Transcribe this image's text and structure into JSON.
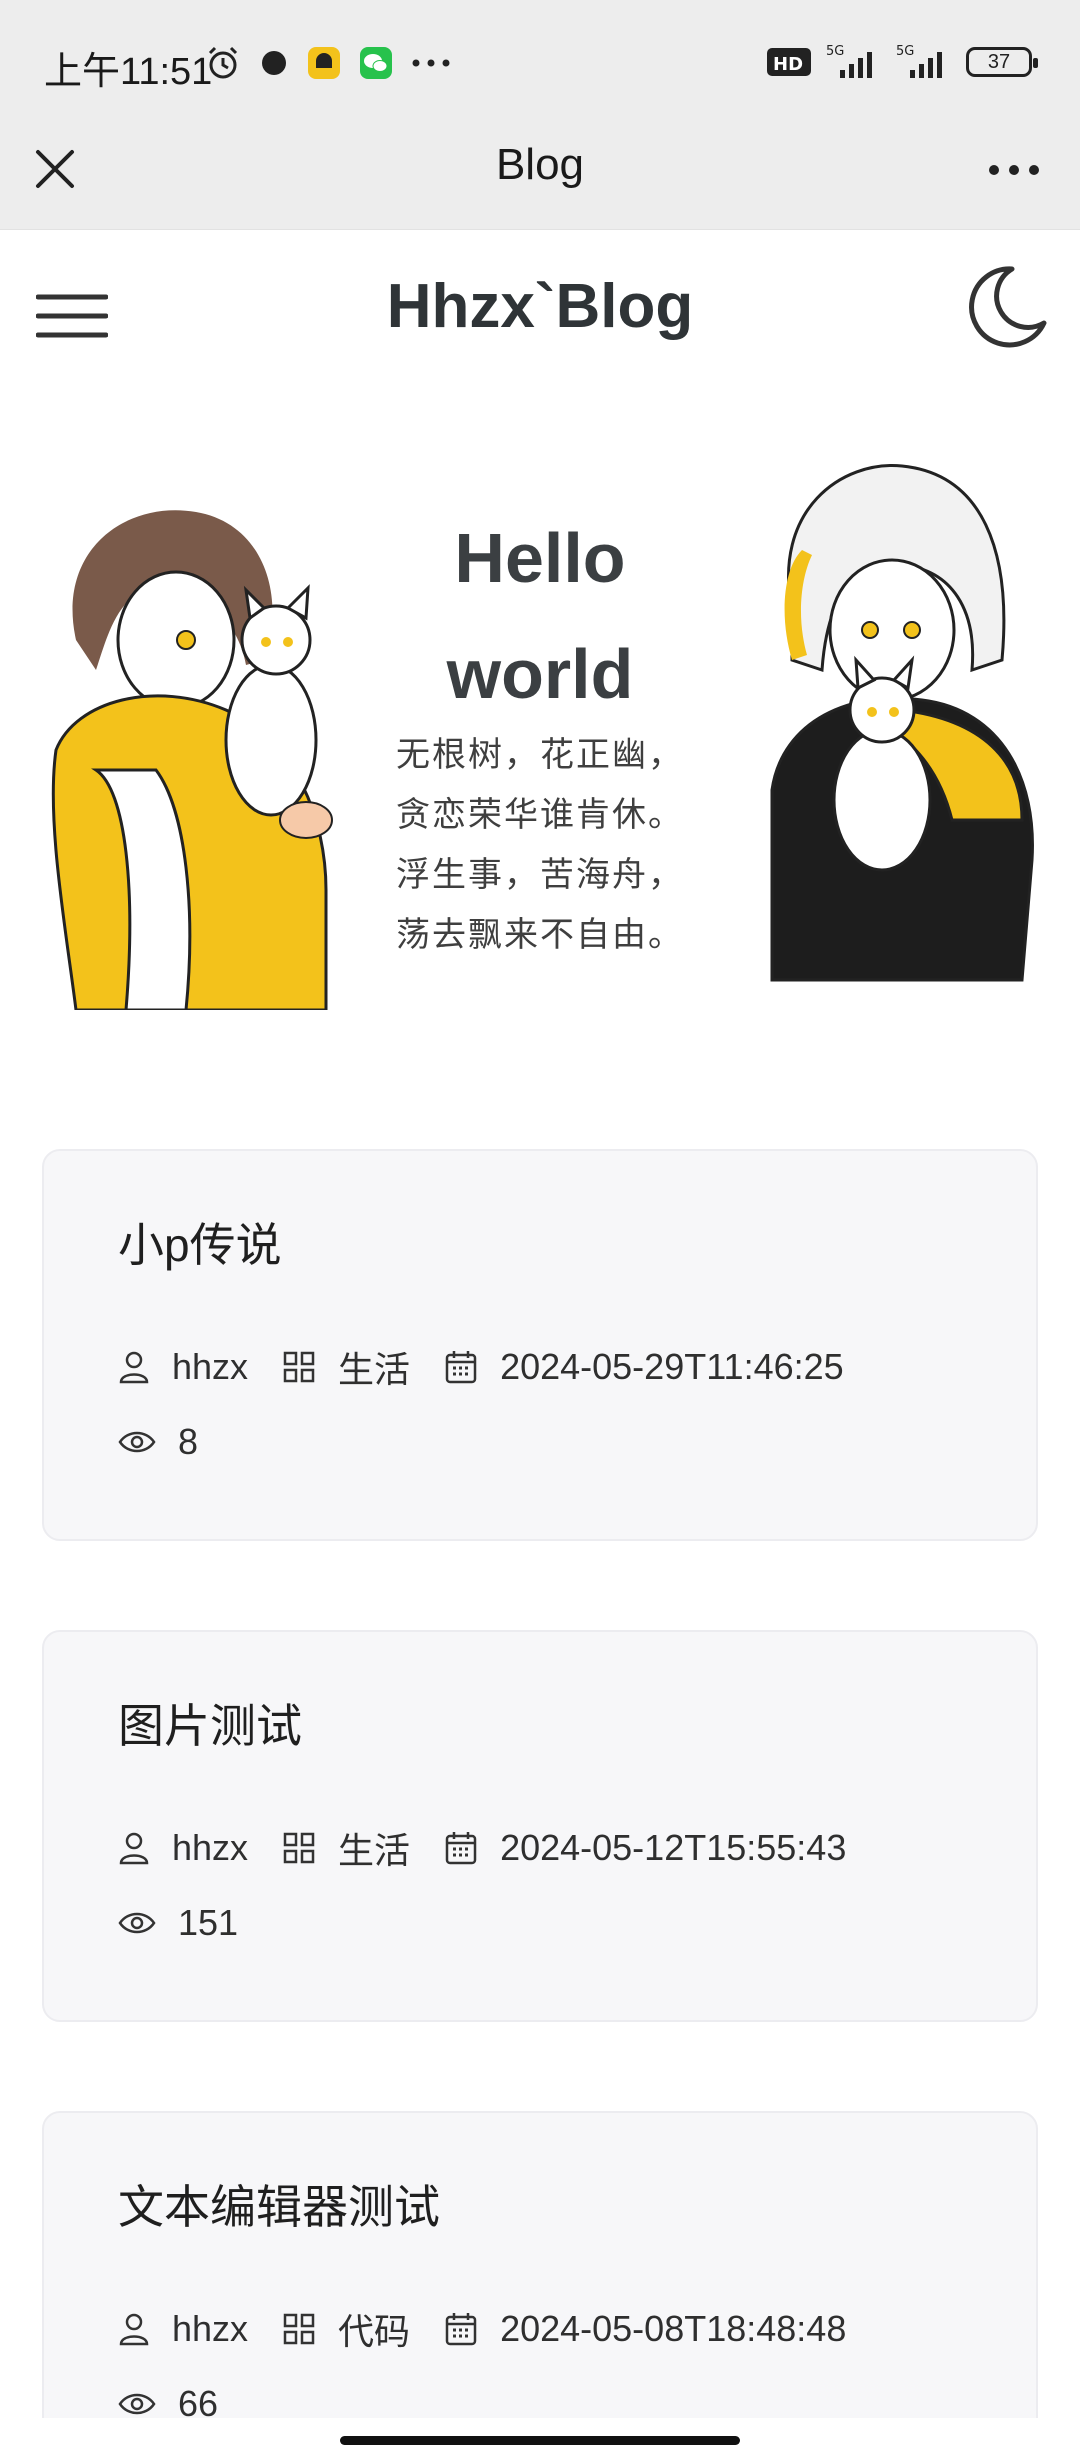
{
  "status_bar": {
    "time": "上午11:51",
    "network_1": "5G",
    "network_2": "5G",
    "hd_label": "HD",
    "battery": "37"
  },
  "browser": {
    "title": "Blog"
  },
  "site": {
    "title": "Hhzx`Blog"
  },
  "hero": {
    "heading_line1": "Hello",
    "heading_line2": "world",
    "poem": [
      "无根树，花正幽，",
      "贪恋荣华谁肯休。",
      "浮生事，苦海舟，",
      "荡去飘来不自由。"
    ]
  },
  "posts": [
    {
      "title": "小p传说",
      "author": "hhzx",
      "category": "生活",
      "date": "2024-05-29T11:46:25",
      "views": "8"
    },
    {
      "title": "图片测试",
      "author": "hhzx",
      "category": "生活",
      "date": "2024-05-12T15:55:43",
      "views": "151"
    },
    {
      "title": "文本编辑器测试",
      "author": "hhzx",
      "category": "代码",
      "date": "2024-05-08T18:48:48",
      "views": "66"
    }
  ],
  "colors": {
    "accent_yellow": "#f3c21b",
    "card_bg": "#f7f7f9",
    "chrome_bg": "#ededed"
  }
}
